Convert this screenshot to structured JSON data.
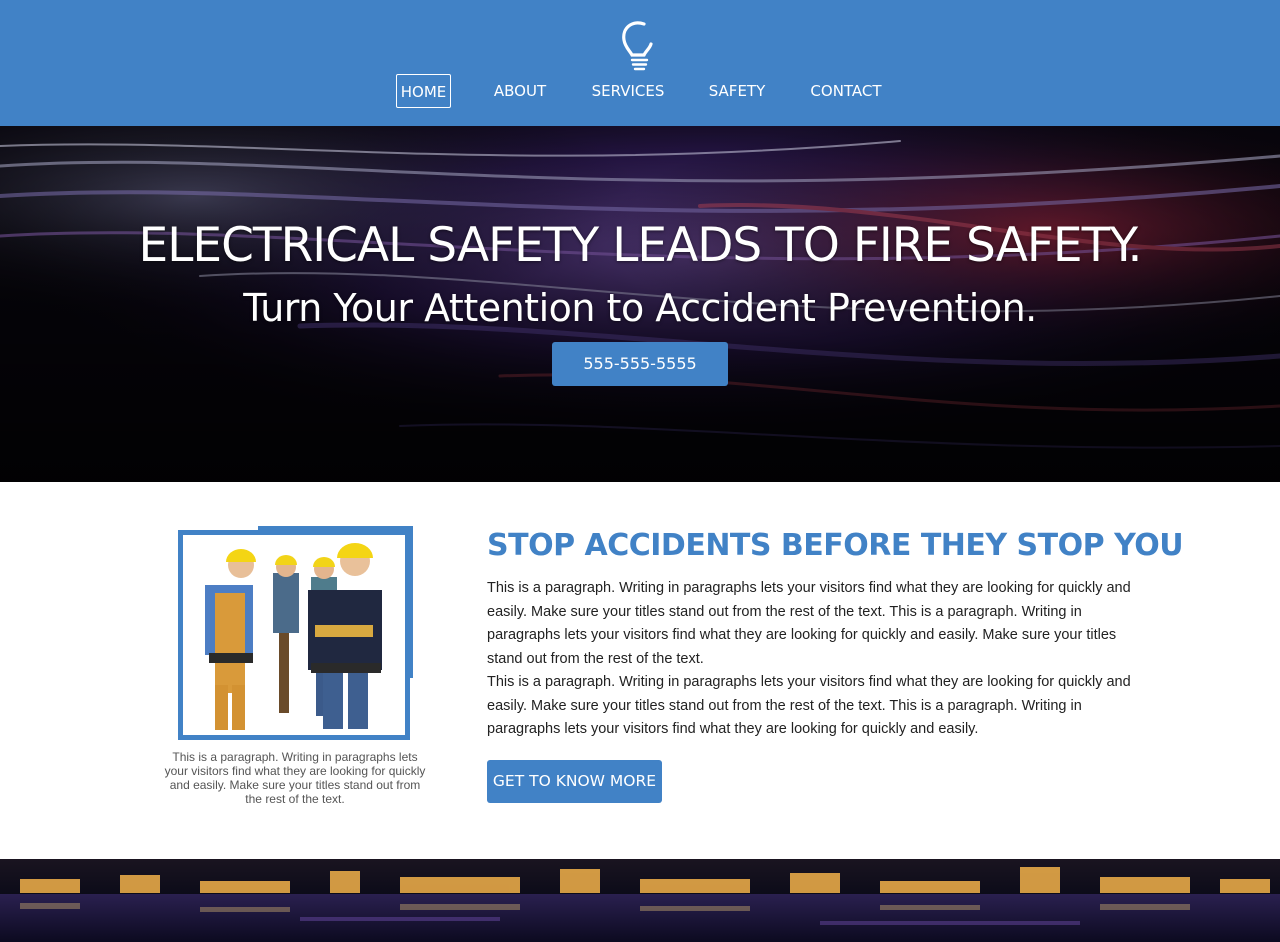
{
  "header": {
    "logo_icon": "lightbulb-icon",
    "nav": [
      {
        "label": "HOME",
        "active": true
      },
      {
        "label": "ABOUT",
        "active": false
      },
      {
        "label": "SERVICES",
        "active": false
      },
      {
        "label": "SAFETY",
        "active": false
      },
      {
        "label": "CONTACT",
        "active": false
      }
    ]
  },
  "hero": {
    "title": "ELECTRICAL SAFETY LEADS TO FIRE SAFETY.",
    "subtitle": "Turn Your Attention to Accident Prevention.",
    "phone_button": "555-555-5555"
  },
  "about": {
    "photo_caption": "This is a paragraph. Writing in paragraphs lets your visitors find what they are looking for quickly and easily. Make sure your titles stand out from the rest of the text.",
    "title": "STOP ACCIDENTS BEFORE THEY STOP YOU",
    "paragraph_1": "This is a paragraph. Writing in paragraphs lets your visitors find what they are looking for quickly and easily. Make sure your titles stand out from the rest of the text. This is a paragraph. Writing in paragraphs lets your visitors find what they are looking for quickly and easily. Make sure your titles stand out from the rest of the text.",
    "paragraph_2": "This is a paragraph. Writing in paragraphs lets your visitors find what they are looking for quickly and easily. Make sure your titles stand out from the rest of the text. This is a paragraph. Writing in paragraphs lets your visitors find what they are looking for quickly and easily.",
    "more_button": "GET TO KNOW MORE"
  },
  "colors": {
    "accent": "#4182c6",
    "text": "#222222",
    "caption": "#555555"
  }
}
